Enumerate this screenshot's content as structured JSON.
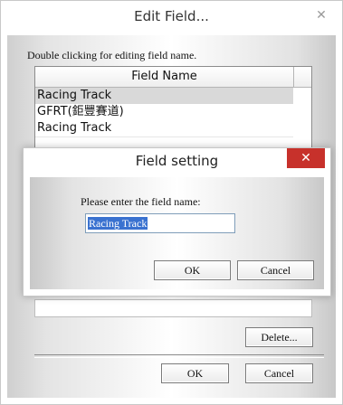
{
  "edit_field": {
    "title": "Edit Field...",
    "close_glyph": "✕",
    "instruction": "Double clicking for editing field name.",
    "column_header": "Field Name",
    "rows": [
      "Racing Track",
      "GFRT(鉅豐賽道)",
      "Racing Track"
    ],
    "delete_label": "Delete...",
    "ok_label": "OK",
    "cancel_label": "Cancel"
  },
  "field_setting": {
    "title": "Field setting",
    "close_glyph": "✕",
    "prompt": "Please enter the field name:",
    "input_value": "Racing Track",
    "ok_label": "OK",
    "cancel_label": "Cancel"
  },
  "colors": {
    "close_red": "#c7312b",
    "selection_blue": "#3a72d0"
  }
}
